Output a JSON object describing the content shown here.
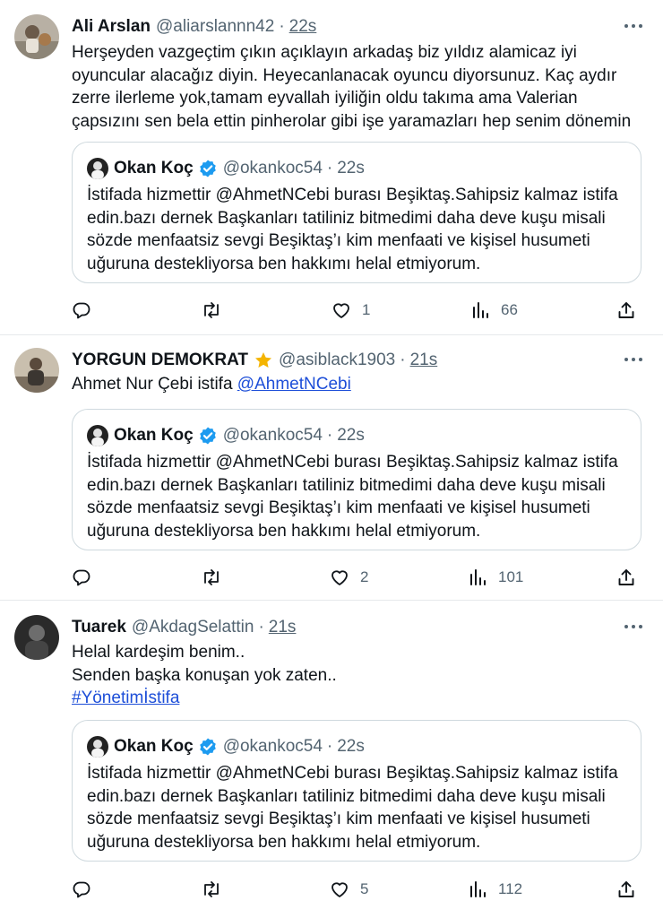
{
  "tweets": [
    {
      "name": "Ali Arslan",
      "handle": "@aliarslannn42",
      "dot": "·",
      "time": "22s",
      "text_lines": [
        "Herşeyden vazgeçtim çıkın açıklayın arkadaş biz yıldız alamicaz iyi",
        "oyuncular alacağız diyin. Heyecanlanacak oyuncu diyorsunuz. Kaç aydır",
        "zerre ilerleme yok,tamam eyvallah iyiliğin oldu takıma ama Valerian",
        "çapsızını sen bela ettin pinherolar gibi işe yaramazları hep senim dönemin"
      ],
      "quote": {
        "name": "Okan Koç",
        "handle": "@okankoc54",
        "dot": "·",
        "time": "22s",
        "lines": [
          "İstifada hizmettir @AhmetNCebi burası Beşiktaş.Sahipsiz kalmaz istifa",
          "edin.bazı dernek Başkanları tatiliniz bitmedimi daha deve kuşu misali",
          "sözde menfaatsiz sevgi Beşiktaş’ı kim menfaati ve kişisel husumeti",
          "uğuruna destekliyorsa ben hakkımı helal etmiyorum."
        ]
      },
      "likes": "1",
      "views": "66",
      "reposts": "",
      "replies": ""
    },
    {
      "name": "YORGUN DEMOKRAT",
      "handle": "@asiblack1903",
      "dot": "·",
      "time": "21s",
      "text_plain": "Ahmet Nur Çebi istifa ",
      "text_link": "@AhmetNCebi",
      "quote": {
        "name": "Okan Koç",
        "handle": "@okankoc54",
        "dot": "·",
        "time": "22s",
        "lines": [
          "İstifada hizmettir @AhmetNCebi burası Beşiktaş.Sahipsiz kalmaz istifa",
          "edin.bazı dernek Başkanları tatiliniz bitmedimi daha deve kuşu misali",
          "sözde menfaatsiz sevgi Beşiktaş’ı kim menfaati ve kişisel husumeti",
          "uğuruna destekliyorsa ben hakkımı helal etmiyorum."
        ]
      },
      "likes": "2",
      "views": "101"
    },
    {
      "name": "Tuarek",
      "handle": "@AkdagSelattin",
      "dot": "·",
      "time": "21s",
      "text_lines": [
        "Helal kardeşim benim..",
        "Senden başka konuşan yok zaten.."
      ],
      "hashtag": "#Yönetimİstifa",
      "quote": {
        "name": "Okan Koç",
        "handle": "@okankoc54",
        "dot": "·",
        "time": "22s",
        "lines": [
          "İstifada hizmettir @AhmetNCebi burası Beşiktaş.Sahipsiz kalmaz istifa",
          "edin.bazı dernek Başkanları tatiliniz bitmedimi daha deve kuşu misali",
          "sözde menfaatsiz sevgi Beşiktaş’ı kim menfaati ve kişisel husumeti",
          "uğuruna destekliyorsa ben hakkımı helal etmiyorum."
        ]
      },
      "likes": "5",
      "views": "112"
    }
  ],
  "icons": {
    "reply": "reply-icon",
    "repost": "repost-icon",
    "like": "heart-icon",
    "views": "analytics-icon",
    "share": "share-icon",
    "more": "more-icon",
    "verified": "verified-badge-icon",
    "star": "star-icon"
  },
  "colors": {
    "text": "#0f1419",
    "secondary": "#536471",
    "link": "#1d4ed8",
    "verified": "#1d9bf0",
    "star": "#f4b400",
    "divider": "#e6e9ec"
  }
}
